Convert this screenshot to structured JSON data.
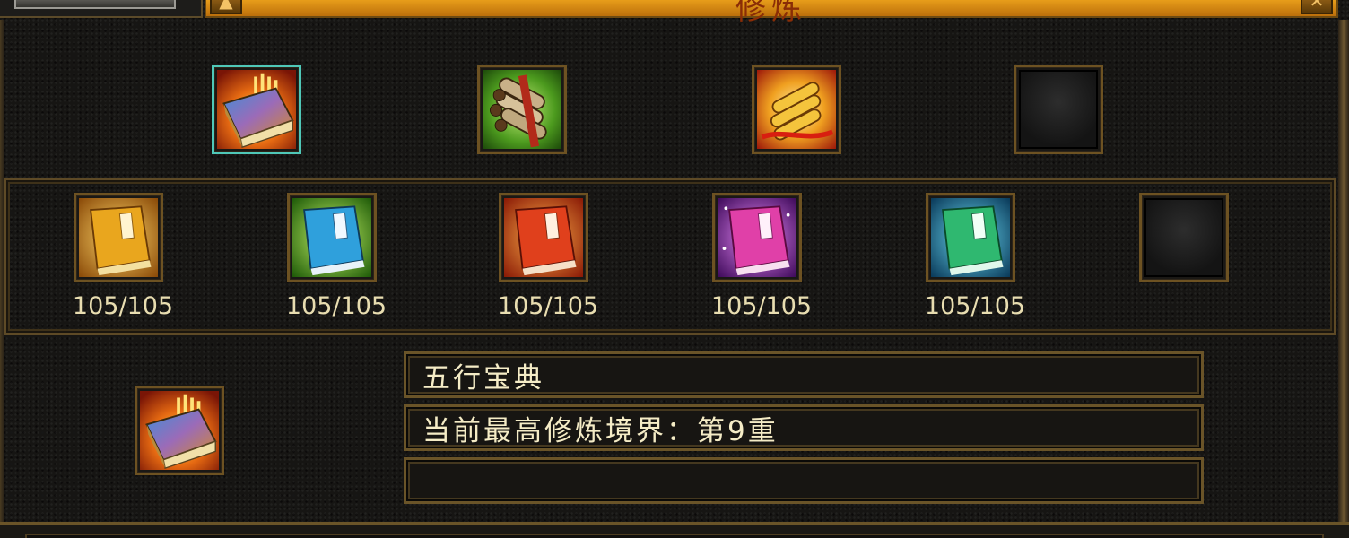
{
  "window": {
    "title": "修炼"
  },
  "top_items": [
    {
      "name": "wuxing-book-icon",
      "state": "selected"
    },
    {
      "name": "scroll-bundle-icon",
      "state": "normal"
    },
    {
      "name": "golden-scroll-icon",
      "state": "normal"
    },
    {
      "name": "empty-slot",
      "state": "empty"
    }
  ],
  "books": [
    {
      "color": "#e7a51d",
      "count": "105/105"
    },
    {
      "color": "#2fa0dc",
      "count": "105/105"
    },
    {
      "color": "#e0401c",
      "count": "105/105"
    },
    {
      "color": "#e040a8",
      "count": "105/105"
    },
    {
      "color": "#2fb870",
      "count": "105/105"
    },
    {
      "color": "",
      "count": ""
    }
  ],
  "detail": {
    "name": "五行宝典",
    "realm": "当前最高修炼境界：第9重",
    "extra": ""
  }
}
